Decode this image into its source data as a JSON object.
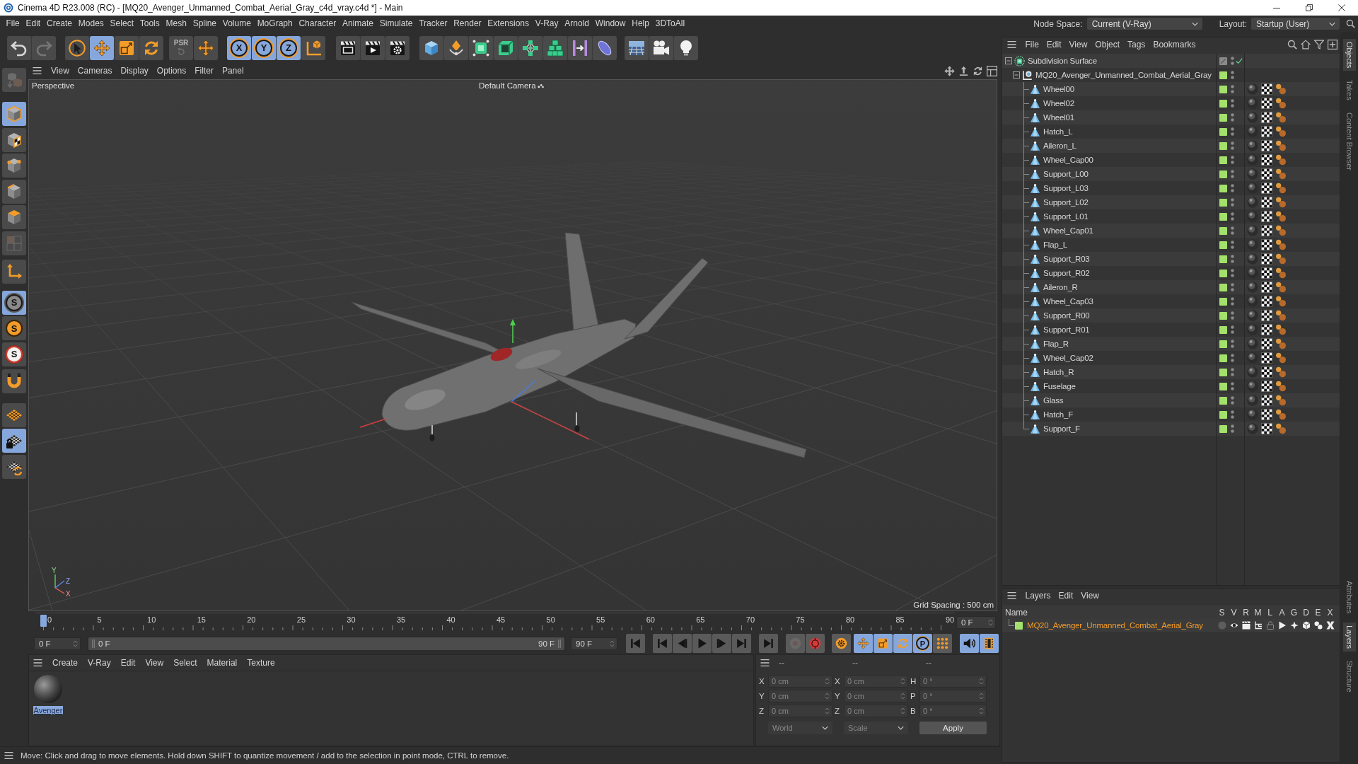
{
  "window": {
    "title": "Cinema 4D R23.008 (RC) - [MQ20_Avenger_Unmanned_Combat_Aerial_Gray_c4d_vray.c4d *] - Main"
  },
  "menu_bar": {
    "items": [
      "File",
      "Edit",
      "Create",
      "Modes",
      "Select",
      "Tools",
      "Mesh",
      "Spline",
      "Volume",
      "MoGraph",
      "Character",
      "Animate",
      "Simulate",
      "Tracker",
      "Render",
      "Extensions",
      "V-Ray",
      "Arnold",
      "Window",
      "Help",
      "3DToAll"
    ],
    "node_space": {
      "label": "Node Space:",
      "value": "Current (V-Ray)"
    },
    "layout": {
      "label": "Layout:",
      "value": "Startup (User)"
    }
  },
  "toolbar": {
    "groups": [
      [
        {
          "kind": "undo",
          "on": false,
          "disabled": false
        },
        {
          "kind": "redo",
          "on": false,
          "disabled": true
        }
      ],
      [
        {
          "kind": "select",
          "on": false,
          "disabled": false
        },
        {
          "kind": "move",
          "on": true,
          "disabled": false
        },
        {
          "kind": "scale",
          "on": false,
          "disabled": false
        },
        {
          "kind": "rotate",
          "on": false,
          "disabled": false
        }
      ],
      [
        {
          "kind": "psr",
          "label": "PSR",
          "on": false,
          "disabled": true
        }
      ],
      [
        {
          "kind": "transform",
          "on": false,
          "disabled": false
        }
      ],
      [
        {
          "kind": "axis",
          "label": "X",
          "on": true,
          "disabled": false
        },
        {
          "kind": "axis",
          "label": "Y",
          "on": true,
          "disabled": false
        },
        {
          "kind": "axis",
          "label": "Z",
          "on": true,
          "disabled": false
        },
        {
          "kind": "coordinates",
          "on": false,
          "disabled": false
        }
      ],
      [
        {
          "kind": "render-view",
          "on": false,
          "disabled": false
        },
        {
          "kind": "render",
          "on": false,
          "disabled": false
        },
        {
          "kind": "render-settings",
          "on": false,
          "disabled": false
        }
      ],
      [
        {
          "kind": "cube",
          "on": false,
          "disabled": false
        },
        {
          "kind": "pen",
          "on": false,
          "disabled": false
        },
        {
          "kind": "subdivision",
          "on": false,
          "disabled": false
        },
        {
          "kind": "extrude",
          "on": false,
          "disabled": false
        },
        {
          "kind": "cloner",
          "on": false,
          "disabled": false
        },
        {
          "kind": "effector",
          "on": false,
          "disabled": false
        },
        {
          "kind": "deformer",
          "on": false,
          "disabled": false
        },
        {
          "kind": "field",
          "on": false,
          "disabled": false
        }
      ],
      [
        {
          "kind": "floor",
          "on": false,
          "disabled": false
        },
        {
          "kind": "camera",
          "on": false,
          "disabled": false
        },
        {
          "kind": "light",
          "on": false,
          "disabled": false
        }
      ]
    ]
  },
  "tool_palette": {
    "groups": [
      [
        {
          "kind": "convert",
          "on": false,
          "disabled": true
        }
      ],
      [
        {
          "kind": "model",
          "on": true,
          "disabled": false
        },
        {
          "kind": "texture",
          "on": false,
          "disabled": false
        },
        {
          "kind": "points",
          "on": false,
          "disabled": false
        },
        {
          "kind": "edges",
          "on": false,
          "disabled": false
        },
        {
          "kind": "polygons",
          "on": false,
          "disabled": false
        },
        {
          "kind": "uv",
          "on": false,
          "disabled": true
        }
      ],
      [
        {
          "kind": "axis-mode",
          "on": false,
          "disabled": false
        }
      ],
      [
        {
          "kind": "snap",
          "label": "S",
          "on": true,
          "disabled": false
        },
        {
          "kind": "snap-quick",
          "label": "S",
          "on": false,
          "disabled": false
        },
        {
          "kind": "snap-ring",
          "label": "S",
          "on": false,
          "disabled": false
        }
      ],
      [
        {
          "kind": "magnet",
          "on": false,
          "disabled": false
        }
      ],
      [
        {
          "kind": "workplane",
          "on": false,
          "disabled": false
        },
        {
          "kind": "workplane-lock",
          "on": true,
          "disabled": false
        },
        {
          "kind": "workplane-align",
          "on": false,
          "disabled": false
        }
      ]
    ]
  },
  "viewport": {
    "menus": [
      "View",
      "Cameras",
      "Display",
      "Options",
      "Filter",
      "Panel"
    ],
    "view_name": "Perspective",
    "camera": "Default Camera",
    "grid_spacing": "Grid Spacing : 500 cm",
    "axis_labels": [
      "Y",
      "Z",
      "X"
    ]
  },
  "timeline": {
    "labels": [
      "0",
      "5",
      "10",
      "15",
      "20",
      "25",
      "30",
      "35",
      "40",
      "45",
      "50",
      "55",
      "60",
      "65",
      "70",
      "75",
      "80",
      "85",
      "90"
    ],
    "playhead": {
      "level": 0
    },
    "frame_field": "0 F"
  },
  "playback": {
    "start_field": "0 F",
    "range": {
      "start": "0 F",
      "end": "90 F",
      "level": 1
    },
    "end_field": "90 F",
    "groups": [
      [
        {
          "kind": "first-frame",
          "on": false,
          "disabled": false
        }
      ],
      [
        {
          "kind": "previous-key",
          "on": false,
          "disabled": false
        },
        {
          "kind": "previous-frame",
          "on": false,
          "disabled": false
        },
        {
          "kind": "play",
          "on": false,
          "disabled": false
        },
        {
          "kind": "next-frame",
          "on": false,
          "disabled": false
        },
        {
          "kind": "next-key",
          "on": false,
          "disabled": false
        }
      ],
      [
        {
          "kind": "last-frame",
          "on": false,
          "disabled": false
        }
      ],
      [
        {
          "kind": "record",
          "on": false,
          "disabled": true
        },
        {
          "kind": "autokey",
          "on": false,
          "disabled": false
        }
      ],
      [
        {
          "kind": "key-settings",
          "on": false,
          "disabled": false
        }
      ],
      [
        {
          "kind": "key-position",
          "on": true,
          "disabled": false
        },
        {
          "kind": "key-scale",
          "on": true,
          "disabled": false
        },
        {
          "kind": "key-rotation",
          "on": true,
          "disabled": false
        },
        {
          "kind": "key-parameter",
          "label": "P",
          "on": true,
          "disabled": false
        },
        {
          "kind": "key-points",
          "on": false,
          "disabled": false
        }
      ],
      [
        {
          "kind": "sound",
          "on": true,
          "disabled": false
        },
        {
          "kind": "film",
          "on": true,
          "disabled": false
        }
      ]
    ]
  },
  "material_manager": {
    "menus": [
      "Create",
      "V-Ray",
      "Edit",
      "View",
      "Select",
      "Material",
      "Texture"
    ],
    "materials": [
      {
        "name": "Avenger",
        "selected": true
      }
    ]
  },
  "coordinates": {
    "disabled": true,
    "columns": [
      {
        "header": "--",
        "fields": [
          {
            "label": "X",
            "value": "0 cm"
          },
          {
            "label": "Y",
            "value": "0 cm"
          },
          {
            "label": "Z",
            "value": "0 cm"
          }
        ]
      },
      {
        "header": "--",
        "fields": [
          {
            "label": "X",
            "value": "0 cm"
          },
          {
            "label": "Y",
            "value": "0 cm"
          },
          {
            "label": "Z",
            "value": "0 cm"
          }
        ]
      },
      {
        "header": "--",
        "fields": [
          {
            "label": "H",
            "value": "0 °"
          },
          {
            "label": "P",
            "value": "0 °"
          },
          {
            "label": "B",
            "value": "0 °"
          }
        ]
      }
    ],
    "dropdowns": [
      "World",
      "Scale"
    ],
    "apply": "Apply"
  },
  "status_bar": {
    "text": "Move: Click and drag to move elements. Hold down SHIFT to quantize movement / add to the selection in point mode, CTRL to remove."
  },
  "object_manager": {
    "menus": [
      "File",
      "Edit",
      "View",
      "Object",
      "Tags",
      "Bookmarks"
    ],
    "objects": [
      {
        "name": "Subdivision Surface",
        "kind": "subdivision",
        "expanded": true,
        "in_layer": false,
        "enabled": true,
        "children": [
          {
            "name": "MQ20_Avenger_Unmanned_Combat_Aerial_Gray",
            "kind": "null",
            "expanded": true,
            "in_layer": true,
            "children": [
              {
                "name": "Wheel00",
                "kind": "polygon",
                "in_layer": true,
                "tags": [
                  {
                    "kind": "texture"
                  },
                  {
                    "kind": "uvw"
                  },
                  {
                    "kind": "phong"
                  }
                ]
              },
              {
                "name": "Wheel02",
                "kind": "polygon",
                "in_layer": true,
                "tags": [
                  {
                    "kind": "texture"
                  },
                  {
                    "kind": "uvw"
                  },
                  {
                    "kind": "phong"
                  }
                ]
              },
              {
                "name": "Wheel01",
                "kind": "polygon",
                "in_layer": true,
                "tags": [
                  {
                    "kind": "texture"
                  },
                  {
                    "kind": "uvw"
                  },
                  {
                    "kind": "phong"
                  }
                ]
              },
              {
                "name": "Hatch_L",
                "kind": "polygon",
                "in_layer": true,
                "tags": [
                  {
                    "kind": "texture"
                  },
                  {
                    "kind": "uvw"
                  },
                  {
                    "kind": "phong"
                  }
                ]
              },
              {
                "name": "Aileron_L",
                "kind": "polygon",
                "in_layer": true,
                "tags": [
                  {
                    "kind": "texture"
                  },
                  {
                    "kind": "uvw"
                  },
                  {
                    "kind": "phong"
                  }
                ]
              },
              {
                "name": "Wheel_Cap00",
                "kind": "polygon",
                "in_layer": true,
                "tags": [
                  {
                    "kind": "texture"
                  },
                  {
                    "kind": "uvw"
                  },
                  {
                    "kind": "phong"
                  }
                ]
              },
              {
                "name": "Support_L00",
                "kind": "polygon",
                "in_layer": true,
                "tags": [
                  {
                    "kind": "texture"
                  },
                  {
                    "kind": "uvw"
                  },
                  {
                    "kind": "phong"
                  }
                ]
              },
              {
                "name": "Support_L03",
                "kind": "polygon",
                "in_layer": true,
                "tags": [
                  {
                    "kind": "texture"
                  },
                  {
                    "kind": "uvw"
                  },
                  {
                    "kind": "phong"
                  }
                ]
              },
              {
                "name": "Support_L02",
                "kind": "polygon",
                "in_layer": true,
                "tags": [
                  {
                    "kind": "texture"
                  },
                  {
                    "kind": "uvw"
                  },
                  {
                    "kind": "phong"
                  }
                ]
              },
              {
                "name": "Support_L01",
                "kind": "polygon",
                "in_layer": true,
                "tags": [
                  {
                    "kind": "texture"
                  },
                  {
                    "kind": "uvw"
                  },
                  {
                    "kind": "phong"
                  }
                ]
              },
              {
                "name": "Wheel_Cap01",
                "kind": "polygon",
                "in_layer": true,
                "tags": [
                  {
                    "kind": "texture"
                  },
                  {
                    "kind": "uvw"
                  },
                  {
                    "kind": "phong"
                  }
                ]
              },
              {
                "name": "Flap_L",
                "kind": "polygon",
                "in_layer": true,
                "tags": [
                  {
                    "kind": "texture"
                  },
                  {
                    "kind": "uvw"
                  },
                  {
                    "kind": "phong"
                  }
                ]
              },
              {
                "name": "Support_R03",
                "kind": "polygon",
                "in_layer": true,
                "tags": [
                  {
                    "kind": "texture"
                  },
                  {
                    "kind": "uvw"
                  },
                  {
                    "kind": "phong"
                  }
                ]
              },
              {
                "name": "Support_R02",
                "kind": "polygon",
                "in_layer": true,
                "tags": [
                  {
                    "kind": "texture"
                  },
                  {
                    "kind": "uvw"
                  },
                  {
                    "kind": "phong"
                  }
                ]
              },
              {
                "name": "Aileron_R",
                "kind": "polygon",
                "in_layer": true,
                "tags": [
                  {
                    "kind": "texture"
                  },
                  {
                    "kind": "uvw"
                  },
                  {
                    "kind": "phong"
                  }
                ]
              },
              {
                "name": "Wheel_Cap03",
                "kind": "polygon",
                "in_layer": true,
                "tags": [
                  {
                    "kind": "texture"
                  },
                  {
                    "kind": "uvw"
                  },
                  {
                    "kind": "phong"
                  }
                ]
              },
              {
                "name": "Support_R00",
                "kind": "polygon",
                "in_layer": true,
                "tags": [
                  {
                    "kind": "texture"
                  },
                  {
                    "kind": "uvw"
                  },
                  {
                    "kind": "phong"
                  }
                ]
              },
              {
                "name": "Support_R01",
                "kind": "polygon",
                "in_layer": true,
                "tags": [
                  {
                    "kind": "texture"
                  },
                  {
                    "kind": "uvw"
                  },
                  {
                    "kind": "phong"
                  }
                ]
              },
              {
                "name": "Flap_R",
                "kind": "polygon",
                "in_layer": true,
                "tags": [
                  {
                    "kind": "texture"
                  },
                  {
                    "kind": "uvw"
                  },
                  {
                    "kind": "phong"
                  }
                ]
              },
              {
                "name": "Wheel_Cap02",
                "kind": "polygon",
                "in_layer": true,
                "tags": [
                  {
                    "kind": "texture"
                  },
                  {
                    "kind": "uvw"
                  },
                  {
                    "kind": "phong"
                  }
                ]
              },
              {
                "name": "Hatch_R",
                "kind": "polygon",
                "in_layer": true,
                "tags": [
                  {
                    "kind": "texture"
                  },
                  {
                    "kind": "uvw"
                  },
                  {
                    "kind": "phong"
                  }
                ]
              },
              {
                "name": "Fuselage",
                "kind": "polygon",
                "in_layer": true,
                "tags": [
                  {
                    "kind": "texture"
                  },
                  {
                    "kind": "uvw"
                  },
                  {
                    "kind": "phong"
                  }
                ]
              },
              {
                "name": "Glass",
                "kind": "polygon",
                "in_layer": true,
                "tags": [
                  {
                    "kind": "texture"
                  },
                  {
                    "kind": "uvw"
                  },
                  {
                    "kind": "phong"
                  }
                ]
              },
              {
                "name": "Hatch_F",
                "kind": "polygon",
                "in_layer": true,
                "tags": [
                  {
                    "kind": "texture"
                  },
                  {
                    "kind": "uvw"
                  },
                  {
                    "kind": "phong"
                  }
                ]
              },
              {
                "name": "Support_F",
                "kind": "polygon",
                "in_layer": true,
                "tags": [
                  {
                    "kind": "texture"
                  },
                  {
                    "kind": "uvw"
                  },
                  {
                    "kind": "phong"
                  }
                ]
              }
            ]
          }
        ]
      }
    ]
  },
  "layer_manager": {
    "menus": [
      "Layers",
      "Edit",
      "View"
    ],
    "columns": [
      "Name",
      "S",
      "V",
      "R",
      "M",
      "L",
      "A",
      "G",
      "D",
      "E",
      "X"
    ],
    "layers": [
      {
        "name": "MQ20_Avenger_Unmanned_Combat_Aerial_Gray",
        "color": "#a4e06c",
        "selected": true,
        "flags": [
          {
            "kind": "solo",
            "on": false
          },
          {
            "kind": "visible",
            "on": true
          },
          {
            "kind": "render",
            "on": true
          },
          {
            "kind": "manager",
            "on": true
          },
          {
            "kind": "locked",
            "on": false
          },
          {
            "kind": "animation",
            "on": true
          },
          {
            "kind": "generators",
            "on": true
          },
          {
            "kind": "deformers",
            "on": true
          },
          {
            "kind": "expressions",
            "on": true
          },
          {
            "kind": "xref",
            "on": true
          }
        ]
      }
    ]
  },
  "side_tabs": {
    "top": [
      {
        "label": "Objects",
        "selected": true
      },
      {
        "label": "Takes",
        "selected": false
      },
      {
        "label": "Content Browser",
        "selected": false
      }
    ],
    "bottom": [
      {
        "label": "Attributes",
        "selected": false
      },
      {
        "label": "Layers",
        "selected": true
      },
      {
        "label": "Structure",
        "selected": false
      }
    ]
  }
}
